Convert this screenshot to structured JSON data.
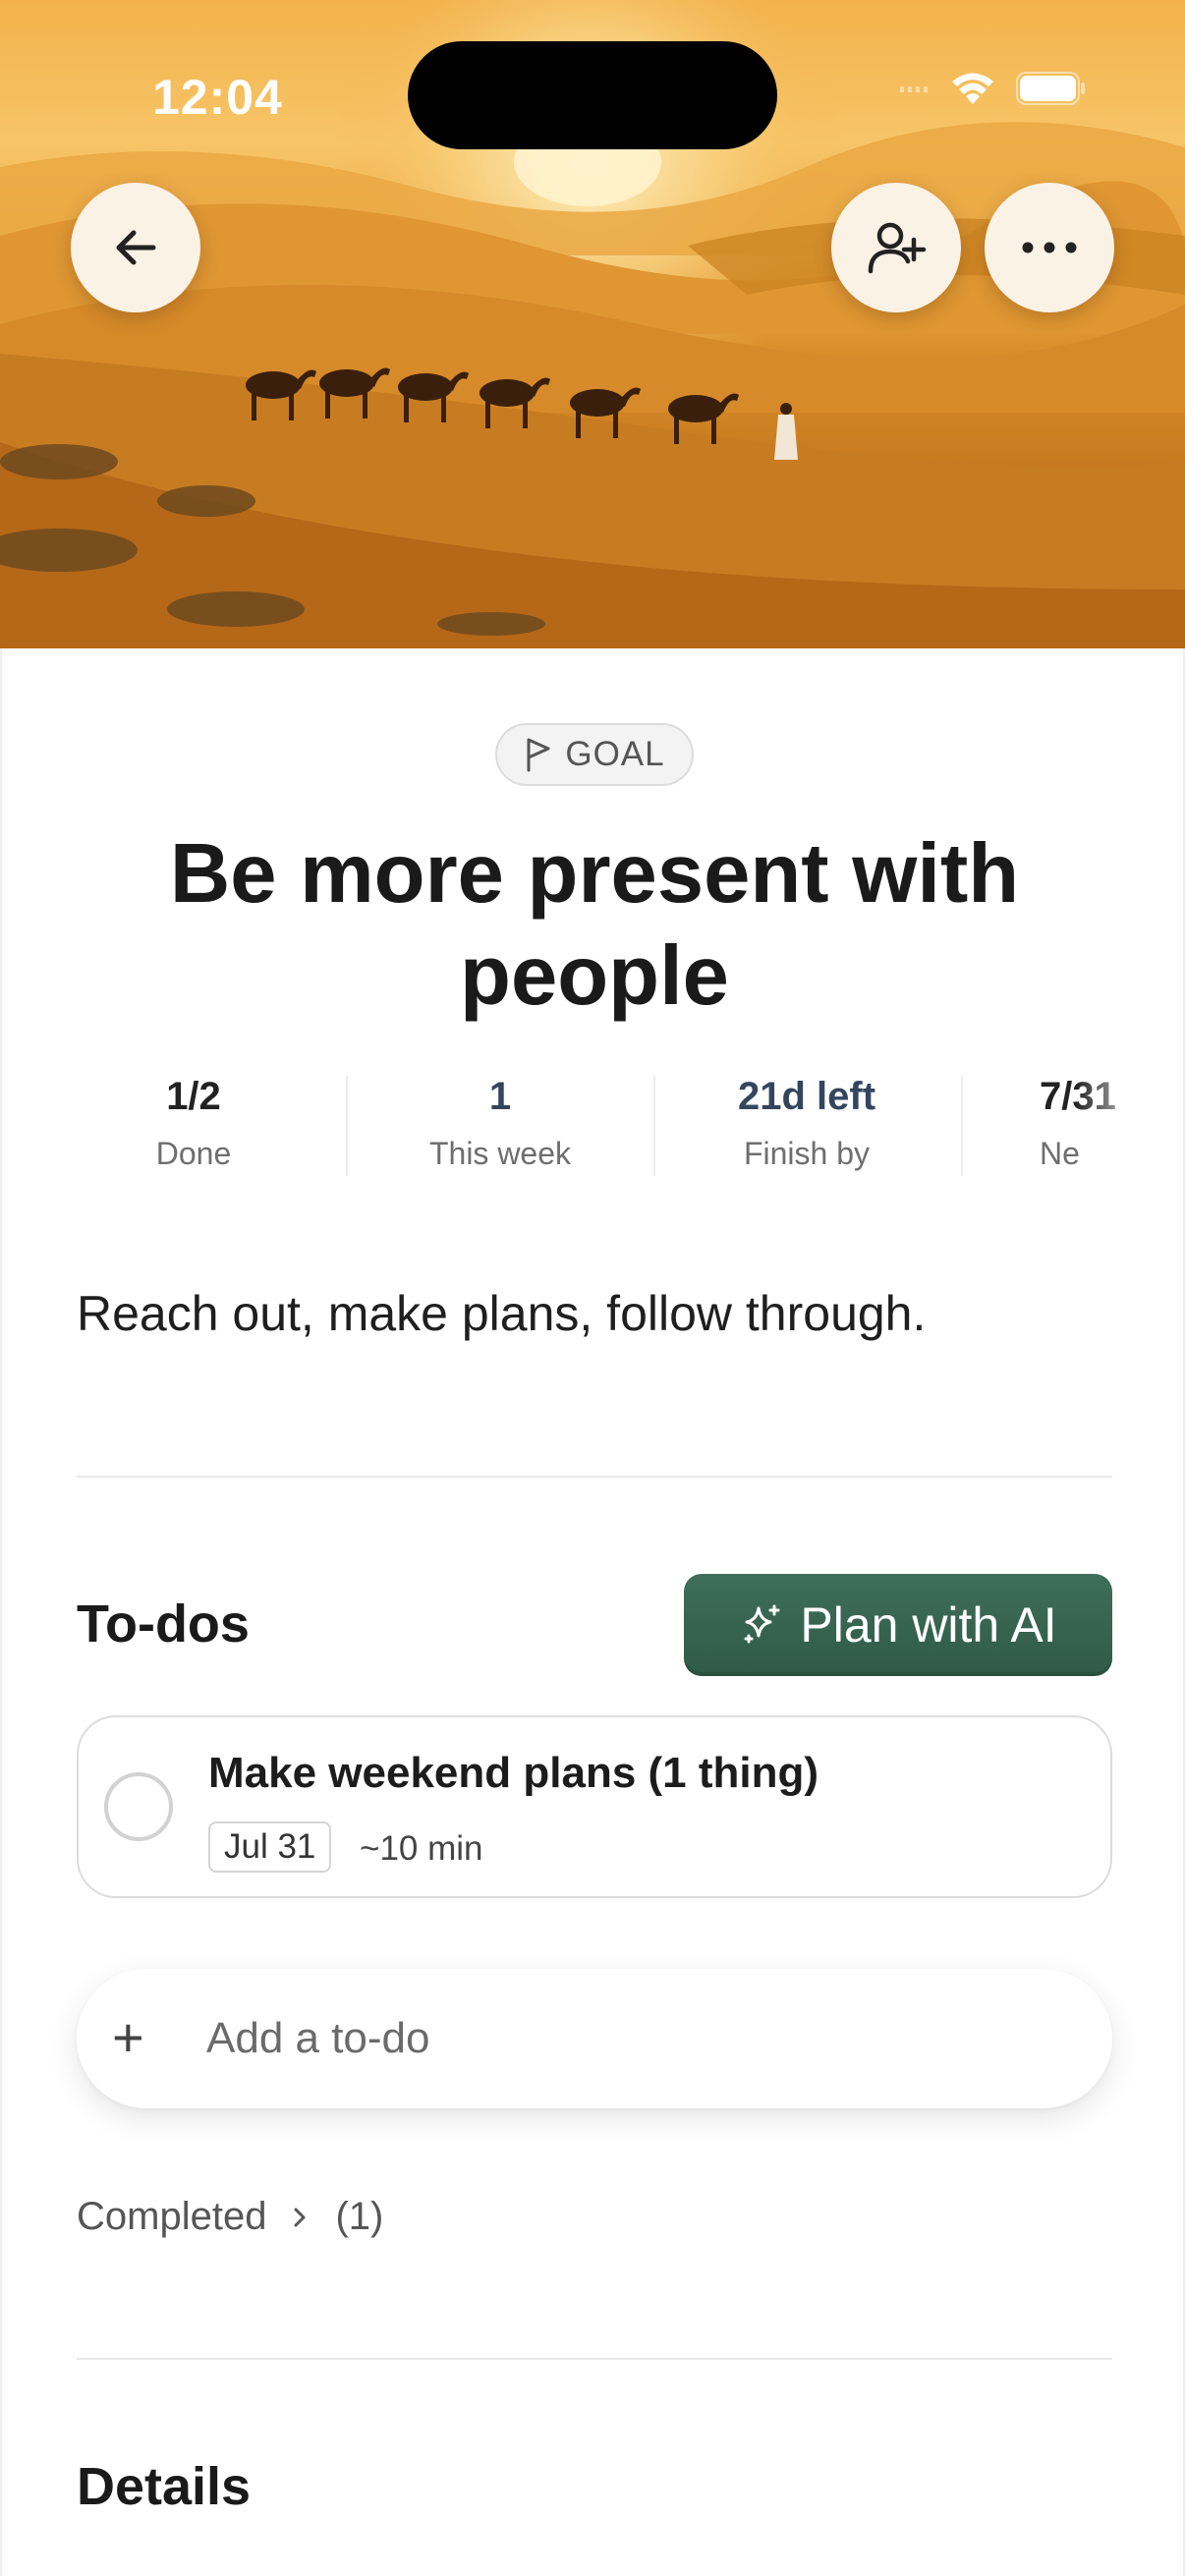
{
  "status_bar": {
    "time": "12:04"
  },
  "header": {
    "back_icon": "arrow-left-icon",
    "share_icon": "add-person-icon",
    "more_icon": "ellipsis-icon"
  },
  "goal": {
    "badge_icon": "flag-icon",
    "badge_label": "GOAL",
    "title_line1": "Be more present with",
    "title_line2": "people",
    "description": "Reach out, make plans, follow through."
  },
  "stats": [
    {
      "value": "1/2",
      "label": "Done"
    },
    {
      "value": "1",
      "label": "This week"
    },
    {
      "value": "21d left",
      "label": "Finish by"
    },
    {
      "value": "7/31",
      "label": "Ne"
    }
  ],
  "todos": {
    "heading": "To-dos",
    "plan_button": "Plan with AI",
    "plan_icon": "sparkle-icon",
    "items": [
      {
        "title": "Make weekend plans (1 thing)",
        "date": "Jul 31",
        "duration": "~10 min"
      }
    ],
    "add_placeholder": "Add a to-do",
    "completed_label": "Completed",
    "completed_count": "(1)"
  },
  "details": {
    "heading": "Details"
  },
  "colors": {
    "accent_green": "#35614e",
    "stat_blue": "#34455e",
    "sand": "#e9a23d"
  }
}
